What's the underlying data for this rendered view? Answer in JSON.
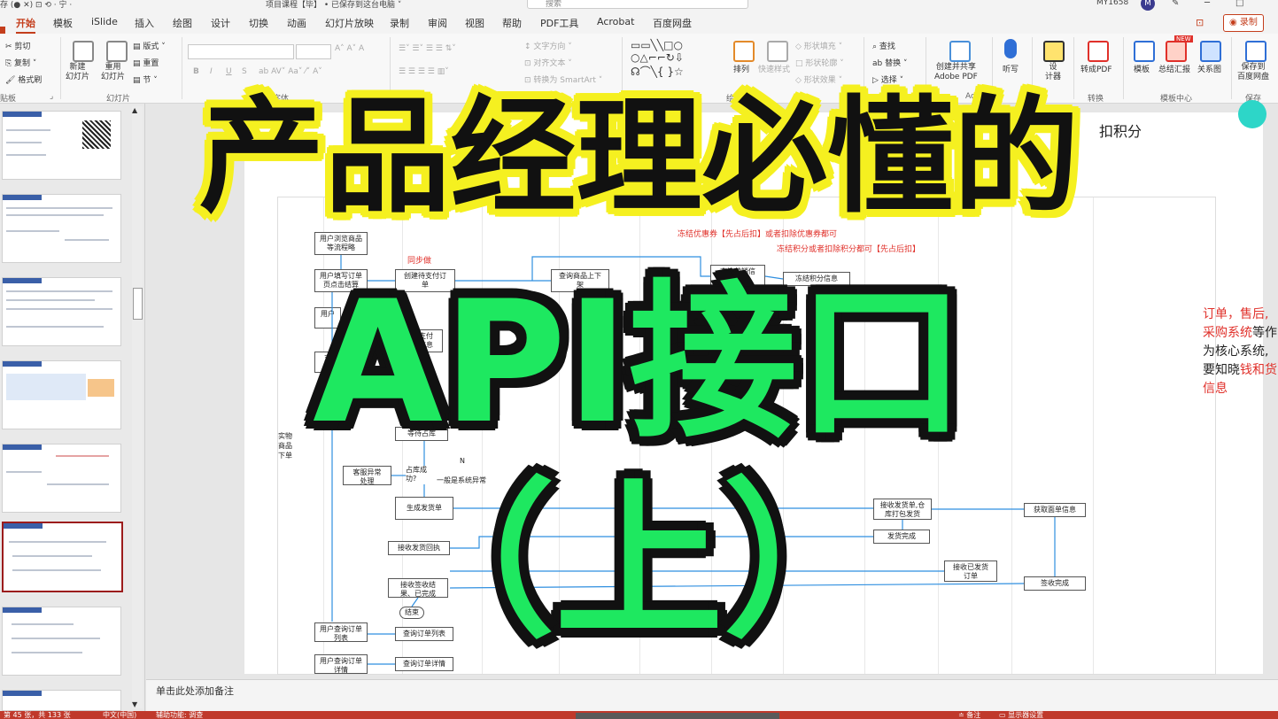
{
  "titlebar": {
    "left_text": "存 (● ✕) ⊡ ⟲ · 宁 ·",
    "doc_title": "项目课程【毕】 • 已保存到这台电脑 ˅",
    "search_placeholder": "搜索",
    "user_id": "MY1658",
    "avatar_letter": "M"
  },
  "tabs": [
    "开始",
    "模板",
    "iSlide",
    "插入",
    "绘图",
    "设计",
    "切换",
    "动画",
    "幻灯片放映",
    "录制",
    "审阅",
    "视图",
    "帮助",
    "PDF工具",
    "Acrobat",
    "百度网盘"
  ],
  "active_tab": "开始",
  "record_button": "◉ 录制",
  "ribbon": {
    "clipboard": {
      "cut": "✂ 剪切",
      "copy": "⎘ 复制 ˅",
      "format": "🖌 格式刷",
      "label": "贴板"
    },
    "slides": {
      "new": "新建\n幻灯片",
      "reuse": "重用\n幻灯片",
      "layout": "▤ 版式 ˅",
      "reset": "▤ 重置",
      "section": "▤ 节 ˅",
      "label": "幻灯片"
    },
    "font": {
      "bold": "B",
      "italic": "I",
      "underline": "U",
      "strike": "S",
      "label": "字体"
    },
    "paragraph": {
      "direction": "↕ 文字方向 ˅",
      "align": "⊡ 对齐文本 ˅",
      "smartart": "⊡ 转换为 SmartArt ˅"
    },
    "drawing": {
      "arrange": "排列",
      "quickstyle": "快速样式",
      "fill": "◇ 形状填充 ˅",
      "outline": "□ 形状轮廓 ˅",
      "effect": "◇ 形状效果 ˅",
      "label": "绘图"
    },
    "editing": {
      "find": "⌕ 查找",
      "replace": "ab 替换 ˅",
      "select": "▷ 选择 ˅"
    },
    "adobe": {
      "share": "创建并共享\nAdobe PDF",
      "label": "Acrobat"
    },
    "voice": {
      "dictate": "听写"
    },
    "calc": {
      "name": "设\n计器"
    },
    "convert": {
      "pdf": "转成PDF",
      "label": "转换"
    },
    "template": {
      "tpl": "模板",
      "summary": "总结汇报",
      "relation": "关系图",
      "label": "模板中心",
      "new_badge": "NEW"
    },
    "save": {
      "baidu": "保存到\n百度网盘",
      "label": "保存"
    }
  },
  "slide_numbers": [
    "",
    "",
    "",
    "",
    "",
    "",
    "",
    ""
  ],
  "slide": {
    "header_right": "扣积分",
    "red_note_1": "冻结优惠券【先占后扣】或者扣除优惠券都可",
    "red_note_2": "冻结积分或者扣除积分都可【先占后扣】",
    "sync_label": "同步做",
    "boxes": {
      "browse": "用户浏览商品\n等流程略",
      "fill_order": "用户填写订单\n页点击结算",
      "user_pay": "用户",
      "pay": "支",
      "create_order": "创建待支付订\n单",
      "query_stock": "查询商品上下\n架",
      "query_marketing": "查询营销信\n息",
      "freeze_points": "冻结积分信息",
      "pay_info": "支付\n信息",
      "wait_stock": "等待占库",
      "service_handle": "客服异常\n处理",
      "occupy_ok": "占库成\n功?",
      "sys_error": "一般是系统异常",
      "gen_ship": "生成发货单",
      "recv_ship": "接收发货单,仓\n库打包发货",
      "ship_done": "发货完成",
      "get_waybill": "获取面单信息",
      "recv_ship_back": "接收发货回执",
      "recv_shipped": "接收已发货\n订单",
      "recv_sign": "接收签收结\n果、已完成",
      "sign_done": "签收完成",
      "end": "结束",
      "user_query_list": "用户查询订单\n列表",
      "query_list": "查询订单列表",
      "user_query_detail": "用户查询订单\n详情",
      "query_detail": "查询订单详情",
      "physical_order": "实物\n商品\n下单",
      "n_label": "N"
    },
    "side_note": {
      "l1_red": "订单，售后,",
      "l2_red": "采购系统",
      "l2_black": "等作",
      "l3": "为核心系统,",
      "l4_black": "要知晓",
      "l4_red": "钱和货",
      "l5_red": "信息"
    }
  },
  "notes_placeholder": "单击此处添加备注",
  "status": {
    "slide_pos": "第 45 张，共 133 张",
    "lang": "中文(中国)",
    "access": "辅助功能: 调查",
    "notes": "≐ 备注",
    "display": "▭ 显示器设置"
  },
  "overlay": {
    "line1": "产品经理必懂的",
    "line2": "API接口",
    "line3": "（上）"
  },
  "colors": {
    "accent": "#c43e1c",
    "overlay_yellow": "#f5f020",
    "overlay_green": "#1ee860",
    "red_note": "#e0302a"
  }
}
